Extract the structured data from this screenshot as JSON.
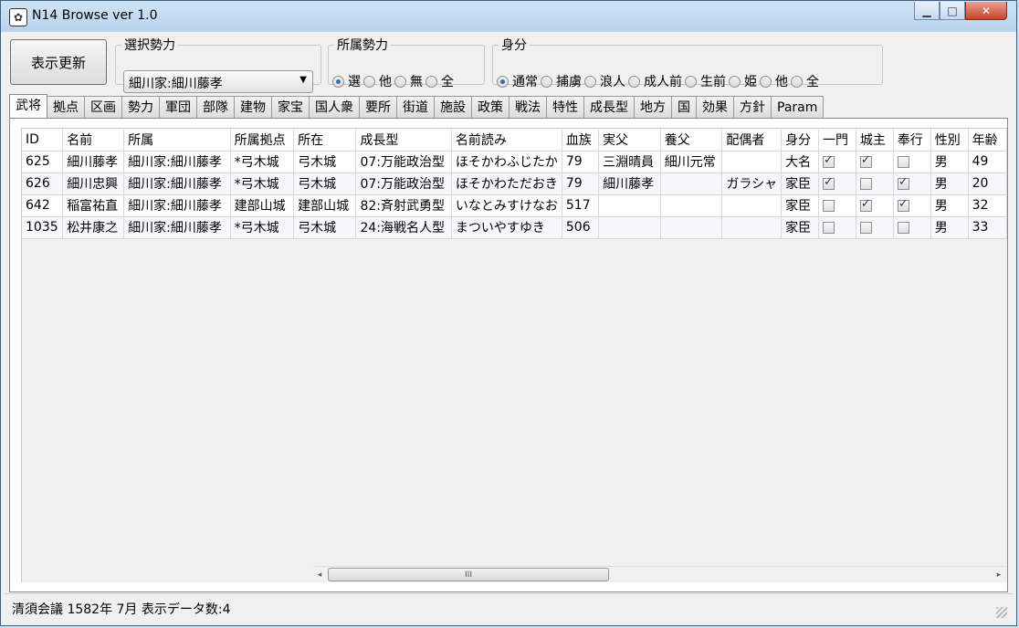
{
  "window": {
    "title": "N14 Browse ver 1.0",
    "minimize": "▁",
    "maximize": "□",
    "close": "✕",
    "icon": "app-emblem-icon"
  },
  "toolbar": {
    "refresh_label": "表示更新",
    "faction_group": {
      "legend": "選択勢力",
      "selected": "細川家:細川藤孝"
    },
    "affiliation_group": {
      "legend": "所属勢力",
      "options": [
        {
          "label": "選",
          "checked": true
        },
        {
          "label": "他",
          "checked": false
        },
        {
          "label": "無",
          "checked": false
        },
        {
          "label": "全",
          "checked": false
        }
      ]
    },
    "status_group": {
      "legend": "身分",
      "options": [
        {
          "label": "通常",
          "checked": true
        },
        {
          "label": "捕虜",
          "checked": false
        },
        {
          "label": "浪人",
          "checked": false
        },
        {
          "label": "成人前",
          "checked": false
        },
        {
          "label": "生前",
          "checked": false
        },
        {
          "label": "姫",
          "checked": false
        },
        {
          "label": "他",
          "checked": false
        },
        {
          "label": "全",
          "checked": false
        }
      ]
    }
  },
  "tabs": [
    "武将",
    "拠点",
    "区画",
    "勢力",
    "軍団",
    "部隊",
    "建物",
    "家宝",
    "国人衆",
    "要所",
    "街道",
    "施設",
    "政策",
    "戦法",
    "特性",
    "成長型",
    "地方",
    "国",
    "効果",
    "方針",
    "Param"
  ],
  "active_tab": 0,
  "grid": {
    "columns": [
      "ID",
      "名前",
      "所属",
      "所属拠点",
      "所在",
      "成長型",
      "名前読み",
      "血族",
      "実父",
      "養父",
      "配偶者",
      "身分",
      "一門",
      "城主",
      "奉行",
      "性別",
      "年齢"
    ],
    "rows": [
      {
        "ID": "625",
        "名前": "細川藤孝",
        "所属": "細川家:細川藤孝",
        "所属拠点": "*弓木城",
        "所在": "弓木城",
        "成長型": "07:万能政治型",
        "名前読み": "ほそかわふじたか",
        "血族": "79",
        "実父": "三淵晴員",
        "養父": "細川元常",
        "配偶者": "",
        "身分": "大名",
        "一門": true,
        "城主": true,
        "奉行": false,
        "性別": "男",
        "年齢": "49"
      },
      {
        "ID": "626",
        "名前": "細川忠興",
        "所属": "細川家:細川藤孝",
        "所属拠点": "*弓木城",
        "所在": "弓木城",
        "成長型": "07:万能政治型",
        "名前読み": "ほそかわただおき",
        "血族": "79",
        "実父": "細川藤孝",
        "養父": "",
        "配偶者": "ガラシャ",
        "身分": "家臣",
        "一門": true,
        "城主": false,
        "奉行": true,
        "性別": "男",
        "年齢": "20"
      },
      {
        "ID": "642",
        "名前": "稲富祐直",
        "所属": "細川家:細川藤孝",
        "所属拠点": " 建部山城",
        "所在": "建部山城",
        "成長型": "82:斉射武勇型",
        "名前読み": "いなとみすけなお",
        "血族": "517",
        "実父": "",
        "養父": "",
        "配偶者": "",
        "身分": "家臣",
        "一門": false,
        "城主": true,
        "奉行": true,
        "性別": "男",
        "年齢": "32"
      },
      {
        "ID": "1035",
        "名前": "松井康之",
        "所属": "細川家:細川藤孝",
        "所属拠点": "*弓木城",
        "所在": "弓木城",
        "成長型": "24:海戦名人型",
        "名前読み": "まついやすゆき",
        "血族": "506",
        "実父": "",
        "養父": "",
        "配偶者": "",
        "身分": "家臣",
        "一門": false,
        "城主": false,
        "奉行": false,
        "性別": "男",
        "年齢": "33"
      }
    ]
  },
  "scrollbar": {
    "left": "◂",
    "right": "▸",
    "grip": "III"
  },
  "status": {
    "text": "清須会議 1582年 7月 表示データ数:4"
  }
}
